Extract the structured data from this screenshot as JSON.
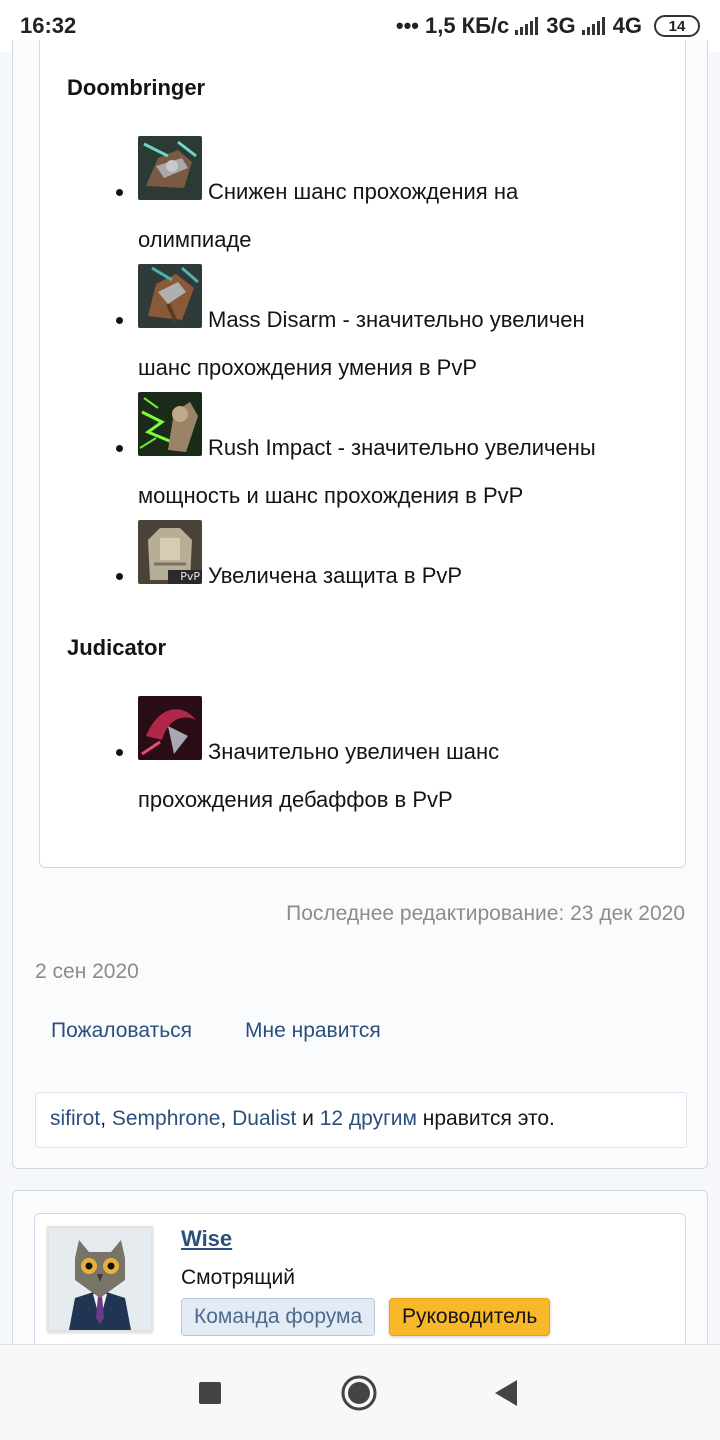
{
  "status_bar": {
    "time": "16:32",
    "speed": "1,5 КБ/с",
    "net1": "3G",
    "net2": "4G",
    "battery": "14"
  },
  "quote": {
    "sections": [
      {
        "class_name": "Doombringer",
        "items": [
          {
            "icon": "gauntlet-skill-icon",
            "line1": "Снижен шанс прохождения на",
            "line2": "олимпиаде"
          },
          {
            "icon": "mass-disarm-icon",
            "line1": "Mass Disarm - значительно увеличен",
            "line2": "шанс прохождения умения в PvP"
          },
          {
            "icon": "rush-impact-icon",
            "line1": "Rush Impact - значительно увеличены",
            "line2": "мощность и шанс прохождения в PvP"
          },
          {
            "icon": "pvp-armor-icon",
            "line1": "Увеличена защита в PvP",
            "icon_text": "PvP"
          }
        ]
      },
      {
        "class_name": "Judicator",
        "items": [
          {
            "icon": "debuff-skill-icon",
            "line1": "Значительно увеличен шанс",
            "line2": "прохождения дебаффов в PvP"
          }
        ]
      }
    ]
  },
  "post": {
    "edited": "Последнее редактирование: 23 дек 2020",
    "date": "2 сен 2020",
    "report_label": "Пожаловаться",
    "like_label": "Мне нравится",
    "likes": {
      "user1": "sifirot",
      "sep1": ", ",
      "user2": "Semphrone",
      "sep2": ", ",
      "user3": "Dualist",
      "and": " и ",
      "others": "12 другим",
      "suffix": " нравится это."
    }
  },
  "next_post": {
    "username": "Wise",
    "user_title": "Смотрящий",
    "badges": [
      "Команда форума",
      "Руководитель"
    ]
  },
  "colors": {
    "link": "#2d4f7c",
    "muted": "#8c8c8c",
    "badge_lead": "#f9b82a",
    "badge_team": "#e3ebf4"
  }
}
